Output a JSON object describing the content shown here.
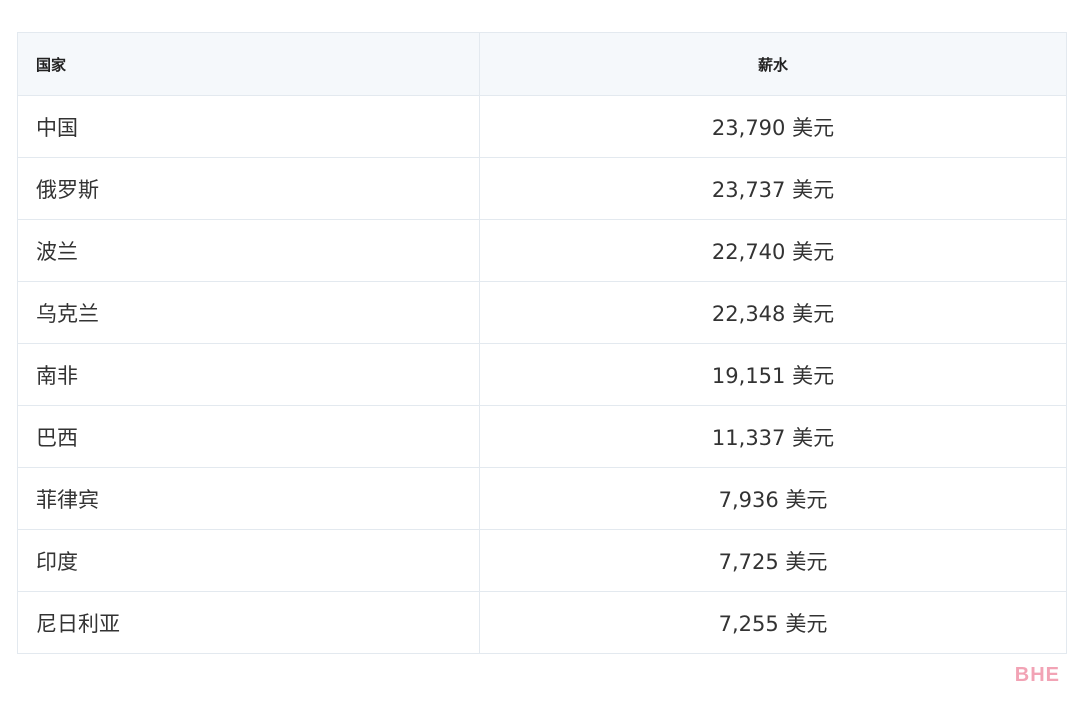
{
  "table": {
    "headers": {
      "country": "国家",
      "salary": "薪水"
    },
    "rows": [
      {
        "country": "中国",
        "salary": "23,790 美元"
      },
      {
        "country": "俄罗斯",
        "salary": "23,737 美元"
      },
      {
        "country": "波兰",
        "salary": "22,740 美元"
      },
      {
        "country": "乌克兰",
        "salary": "22,348 美元"
      },
      {
        "country": "南非",
        "salary": "19,151 美元"
      },
      {
        "country": "巴西",
        "salary": "11,337 美元"
      },
      {
        "country": "菲律宾",
        "salary": "7,936 美元"
      },
      {
        "country": "印度",
        "salary": "7,725 美元"
      },
      {
        "country": "尼日利亚",
        "salary": "7,255 美元"
      }
    ]
  },
  "watermark": {
    "text": "BHE",
    "color": "#f2a3b5"
  },
  "colors": {
    "header_background": "#f5f8fb",
    "border": "#e3e9ef",
    "text": "#333333"
  }
}
